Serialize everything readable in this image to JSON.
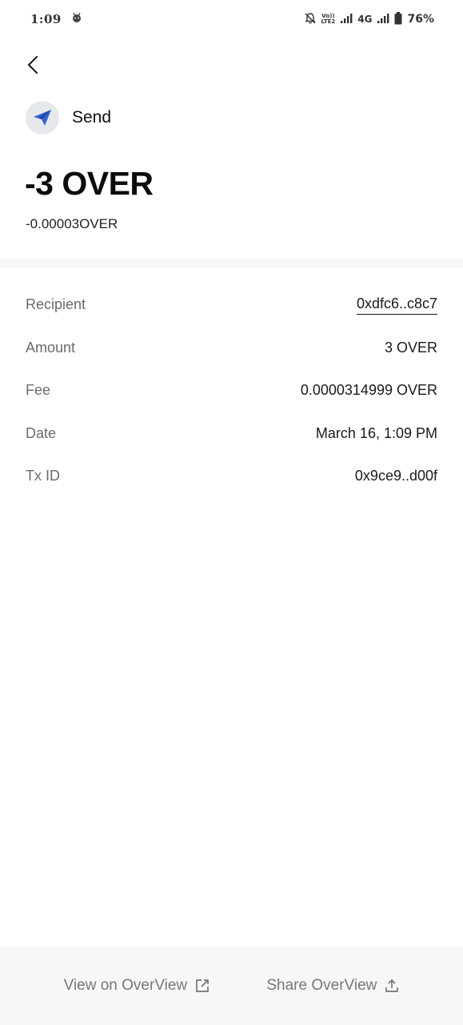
{
  "status_bar": {
    "time": "1:09",
    "network_label_top": "Vo))",
    "network_label_bottom": "LTE2",
    "network_type": "4G",
    "battery": "76%",
    "icons": [
      "android-notification-icon",
      "mute-bell-icon",
      "signal-icon",
      "battery-icon"
    ]
  },
  "header": {
    "back_icon": "chevron-left-icon",
    "type_icon": "paper-plane-icon",
    "type_label": "Send",
    "amount": "-3 OVER",
    "fee_amount": "-0.00003OVER"
  },
  "details": {
    "rows": [
      {
        "label": "Recipient",
        "value": "0xdfc6..c8c7"
      },
      {
        "label": "Amount",
        "value": "3 OVER"
      },
      {
        "label": "Fee",
        "value": "0.0000314999 OVER"
      },
      {
        "label": "Date",
        "value": "March 16, 1:09 PM"
      },
      {
        "label": "Tx ID",
        "value": "0x9ce9..d00f"
      }
    ]
  },
  "footer": {
    "view_label": "View on OverView",
    "view_icon": "external-link-icon",
    "share_label": "Share OverView",
    "share_icon": "share-upload-icon"
  },
  "colors": {
    "accent_blue": "#2f63d6",
    "icon_bg": "#e6e8ec",
    "muted_text": "#6b6b6b",
    "footer_bg": "#f7f7f8"
  }
}
